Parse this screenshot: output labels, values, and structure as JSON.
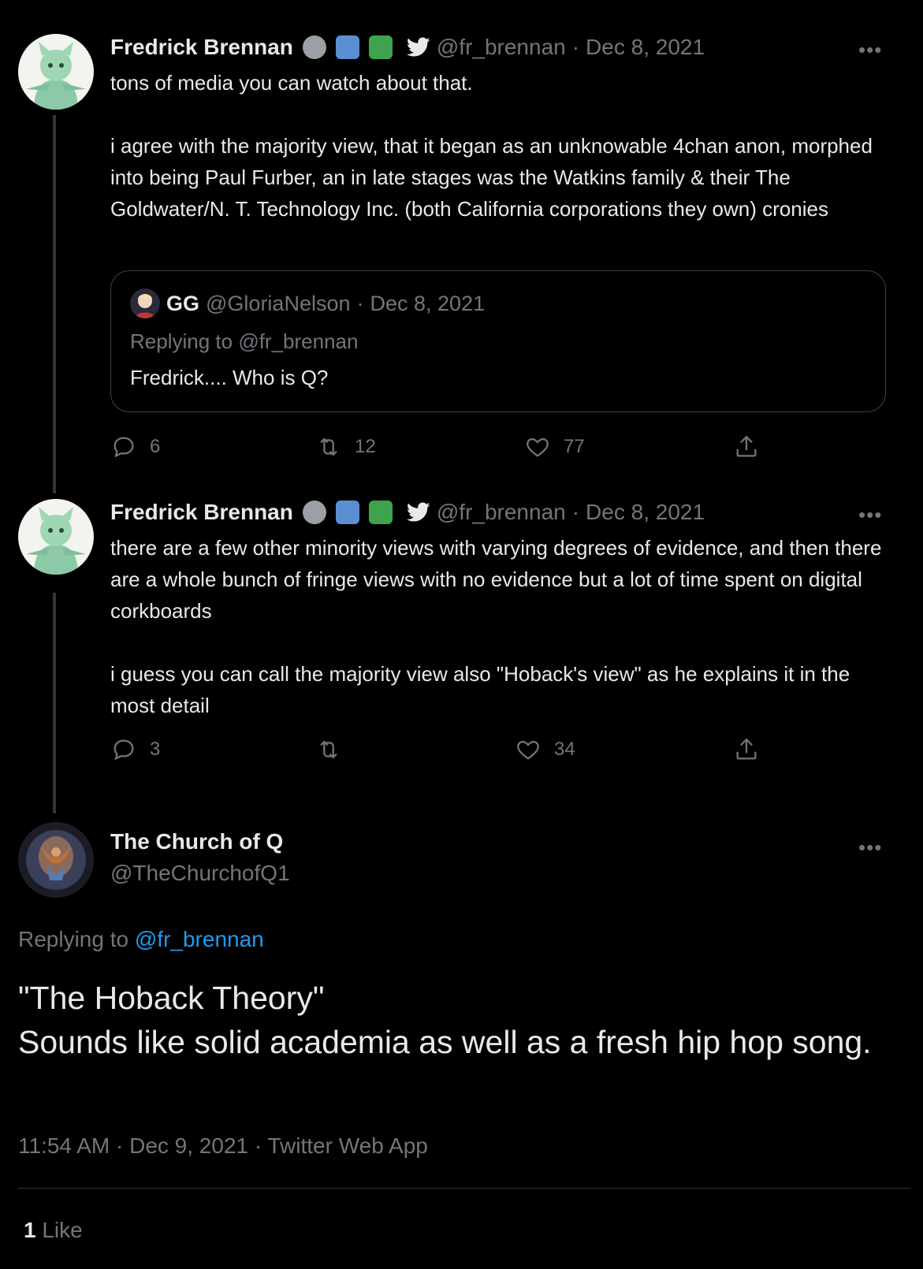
{
  "tweets": [
    {
      "name": "Fredrick Brennan",
      "handle": "@fr_brennan",
      "date": "Dec 8, 2021",
      "text": "tons of media you can watch about that.\n\ni agree with the majority view, that it began as an unknowable 4chan anon, morphed into being Paul Furber, an in late stages was the Watkins family & their The Goldwater/N. T. Technology Inc. (both California corporations they own) cronies",
      "quote": {
        "name": "GG",
        "handle": "@GloriaNelson",
        "date": "Dec 8, 2021",
        "replying_prefix": "Replying to",
        "replying_to": "@fr_brennan",
        "text": "Fredrick.... Who is Q?"
      },
      "replies": "6",
      "retweets": "12",
      "likes": "77"
    },
    {
      "name": "Fredrick Brennan",
      "handle": "@fr_brennan",
      "date": "Dec 8, 2021",
      "text": "there are a few other minority views with varying degrees of evidence, and then there are a whole bunch of fringe views with no evidence but a lot of time spent on digital corkboards\n\ni guess you can call the majority view also \"Hoback's view\" as he explains it in the most detail",
      "replies": "3",
      "retweets": "",
      "likes": "34"
    }
  ],
  "main": {
    "name": "The Church of Q",
    "handle": "@TheChurchofQ1",
    "replying_prefix": "Replying to",
    "replying_to": "@fr_brennan",
    "text": "\"The Hoback Theory\"\nSounds like solid academia as well as a fresh hip hop song.",
    "timestamp": "11:54 AM · Dec 9, 2021 · Twitter Web App",
    "like_count": "1",
    "like_label": "Like"
  },
  "separator": "·",
  "more_glyph": "•••",
  "icons": {
    "verified_bird": "twitter-bird-icon",
    "reply": "reply-icon",
    "retweet": "retweet-icon",
    "like": "heart-icon",
    "share": "share-icon"
  },
  "colors": {
    "background": "#000000",
    "text": "#e7e9ea",
    "muted": "#71767b",
    "link": "#1d9bf0"
  }
}
